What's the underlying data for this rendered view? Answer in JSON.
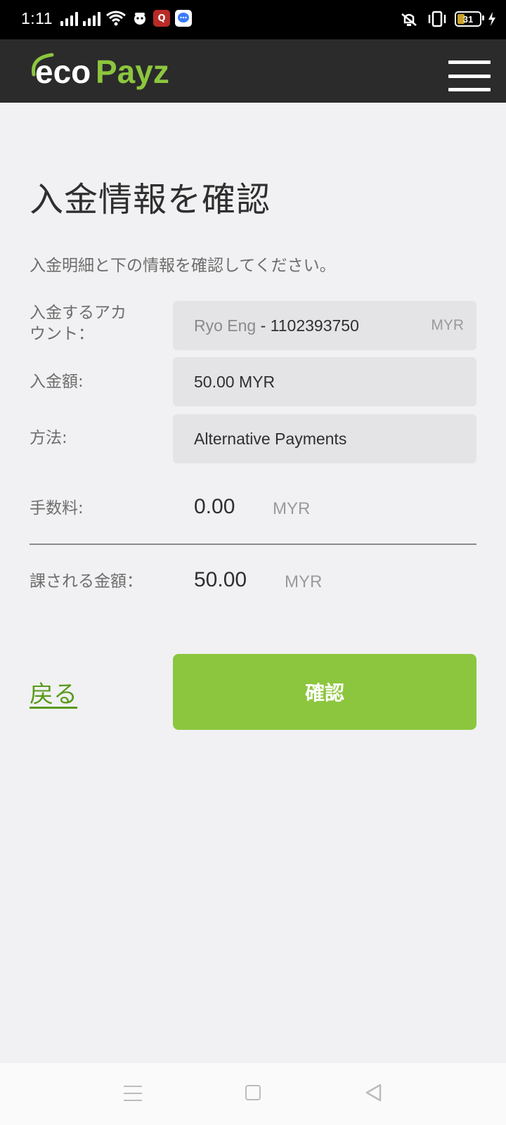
{
  "status_bar": {
    "time": "1:11",
    "battery": "31",
    "icons": [
      "signal-icon",
      "signal-icon",
      "wifi-icon",
      "app-notification-icon",
      "quora-icon",
      "messages-icon",
      "vibrate-icon",
      "battery-icon",
      "charging-icon"
    ]
  },
  "header": {
    "logo_text_eco": "eco",
    "logo_text_payz": "Payz",
    "menu_icon": "hamburger-menu-icon"
  },
  "page": {
    "title": "入金情報を確認",
    "subtitle": "入金明細と下の情報を確認してください。"
  },
  "details": {
    "account_label_line1": "入金するアカ",
    "account_label_line2": "ウント：",
    "account_name": "Ryo Eng",
    "account_number": " - 1102393750",
    "account_currency": "MYR",
    "amount_label": "入金額:",
    "amount_value": "50.00 MYR",
    "method_label": "方法:",
    "method_value": "Alternative Payments",
    "fee_label": "手数料:",
    "fee_value": "0.00",
    "fee_currency": "MYR",
    "charged_label": "課される金額：",
    "charged_value": "50.00",
    "charged_currency": "MYR"
  },
  "actions": {
    "back_label": "戻る",
    "confirm_label": "確認"
  },
  "colors": {
    "header_bg": "#2b2b2b",
    "brand_green": "#8cc63e",
    "link_green": "#5a9a1a",
    "page_bg": "#f1f1f3"
  }
}
